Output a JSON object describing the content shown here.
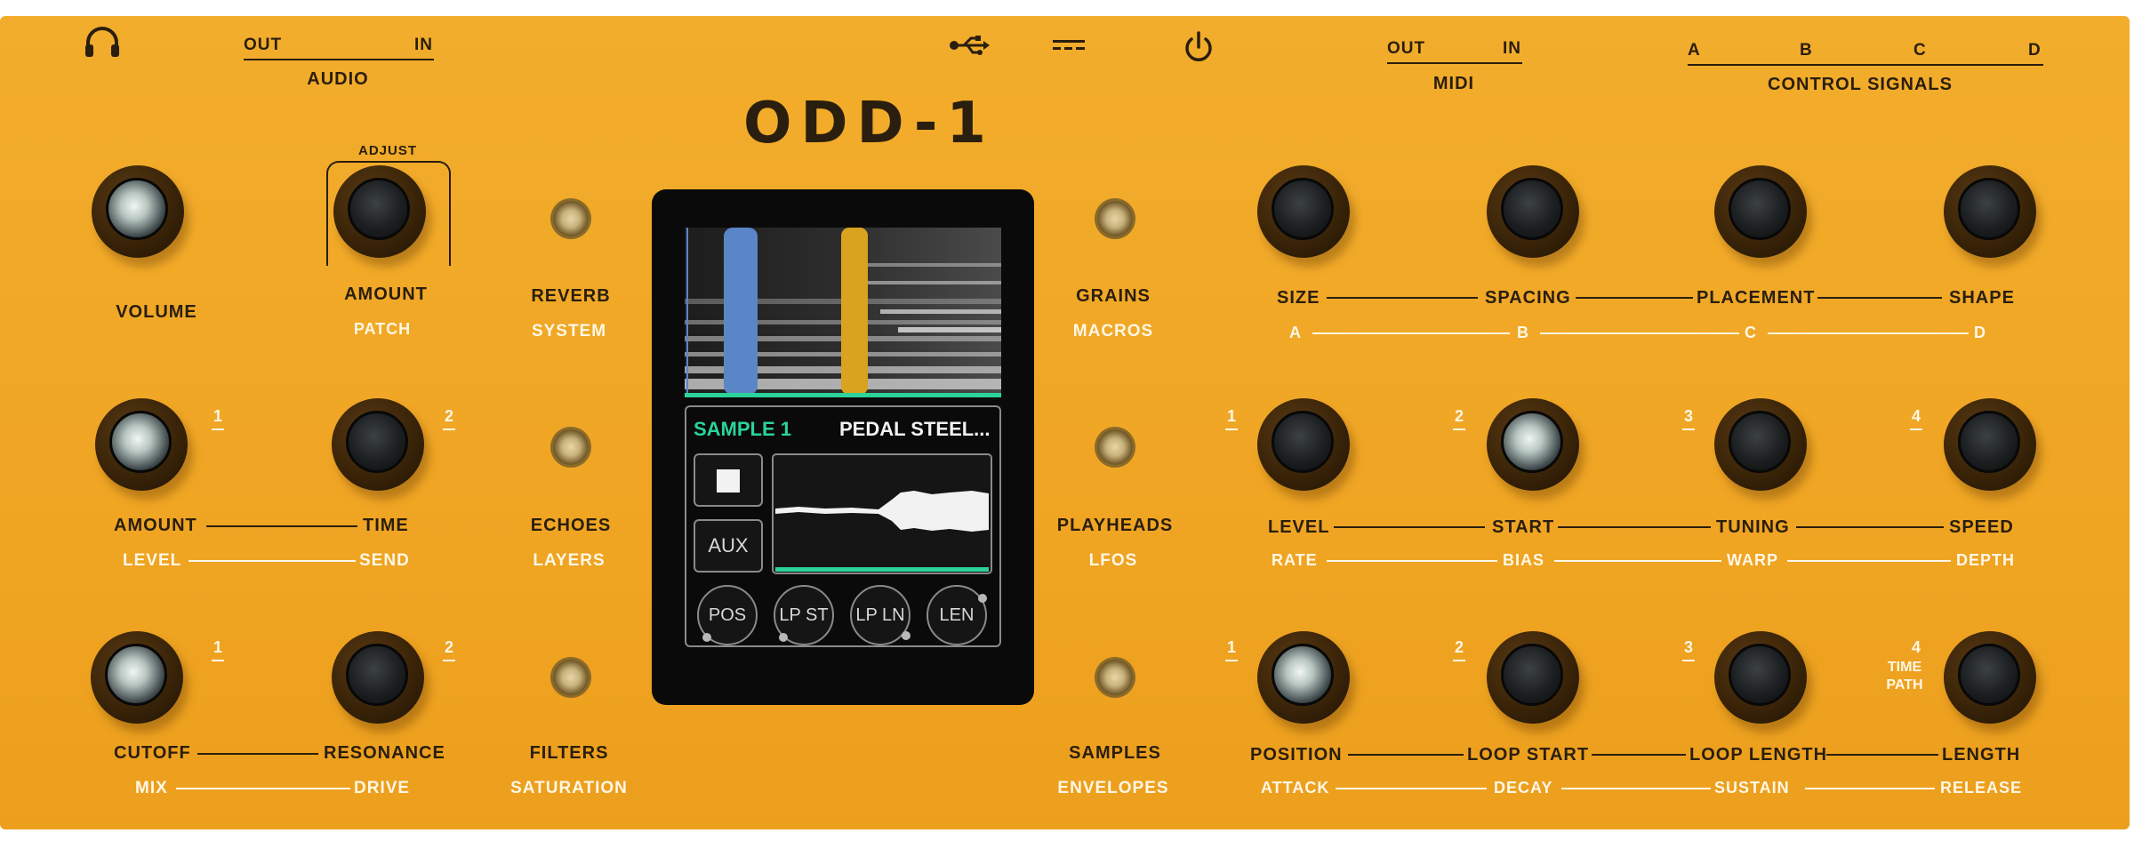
{
  "device": {
    "logo": "ODD-1",
    "panel_color": "#f0a624",
    "io": {
      "headphone_icon": "headphone-icon",
      "audio_out": "OUT",
      "audio_in": "IN",
      "audio_label": "AUDIO",
      "usb_icon": "usb-icon",
      "dc_icon": "dc-power-icon",
      "power_icon": "power-icon",
      "midi_out": "OUT",
      "midi_in": "IN",
      "midi_label": "MIDI",
      "cv": [
        "A",
        "B",
        "C",
        "D"
      ],
      "cv_label": "CONTROL SIGNALS"
    },
    "left": {
      "volume": "VOLUME",
      "adjust": "ADJUST",
      "amount": "AMOUNT",
      "patch": "PATCH",
      "row2": {
        "num1": "1",
        "num2": "2",
        "top": [
          "AMOUNT",
          "TIME"
        ],
        "bottom": [
          "LEVEL",
          "SEND"
        ]
      },
      "row3": {
        "num1": "1",
        "num2": "2",
        "top": [
          "CUTOFF",
          "RESONANCE"
        ],
        "bottom": [
          "MIX",
          "DRIVE"
        ]
      }
    },
    "left_buttons": [
      {
        "top": "REVERB",
        "bottom": "SYSTEM"
      },
      {
        "top": "ECHOES",
        "bottom": "LAYERS"
      },
      {
        "top": "FILTERS",
        "bottom": "SATURATION"
      }
    ],
    "right_buttons": [
      {
        "top": "GRAINS",
        "bottom": "MACROS"
      },
      {
        "top": "PLAYHEADS",
        "bottom": "LFOS"
      },
      {
        "top": "SAMPLES",
        "bottom": "ENVELOPES"
      }
    ],
    "right": {
      "row1": {
        "top": [
          "SIZE",
          "SPACING",
          "PLACEMENT",
          "SHAPE"
        ],
        "bottom": [
          "A",
          "B",
          "C",
          "D"
        ]
      },
      "row2": {
        "nums": [
          "1",
          "2",
          "3",
          "4"
        ],
        "top": [
          "LEVEL",
          "START",
          "TUNING",
          "SPEED"
        ],
        "bottom": [
          "RATE",
          "BIAS",
          "WARP",
          "DEPTH"
        ]
      },
      "row3": {
        "nums": [
          "1",
          "2",
          "3",
          "4"
        ],
        "extra": [
          "TIME",
          "PATH"
        ],
        "top": [
          "POSITION",
          "LOOP START",
          "LOOP LENGTH",
          "LENGTH"
        ],
        "bottom": [
          "ATTACK",
          "DECAY",
          "SUSTAIN",
          "RELEASE"
        ]
      }
    },
    "screen": {
      "sample_name": "SAMPLE 1",
      "patch_name": "PEDAL STEEL...",
      "stop_icon": "stop-icon",
      "aux": "AUX",
      "knobs": [
        "POS",
        "LP ST",
        "LP LN",
        "LEN"
      ],
      "colors": {
        "accent_green": "#2bd39b",
        "playhead_blue": "#5a86c8",
        "playhead_gold": "#d9a21f"
      }
    }
  }
}
